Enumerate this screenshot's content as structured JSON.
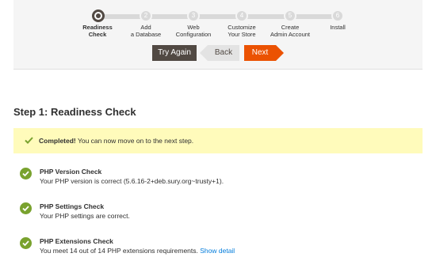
{
  "wizard": {
    "steps": [
      {
        "number": "1",
        "label_line1": "Readiness",
        "label_line2": "Check",
        "active": true
      },
      {
        "number": "2",
        "label_line1": "Add",
        "label_line2": "a Database",
        "active": false
      },
      {
        "number": "3",
        "label_line1": "Web",
        "label_line2": "Configuration",
        "active": false
      },
      {
        "number": "4",
        "label_line1": "Customize",
        "label_line2": "Your Store",
        "active": false
      },
      {
        "number": "5",
        "label_line1": "Create",
        "label_line2": "Admin Account",
        "active": false
      },
      {
        "number": "6",
        "label_line1": "Install",
        "label_line2": "",
        "active": false
      }
    ],
    "buttons": {
      "try_again": "Try Again",
      "back": "Back",
      "next": "Next"
    }
  },
  "page": {
    "title": "Step 1: Readiness Check"
  },
  "message": {
    "strong": "Completed!",
    "text": " You can now move on to the next step."
  },
  "checks": [
    {
      "title": "PHP Version Check",
      "description": "Your PHP version is correct (5.6.16-2+deb.sury.org~trusty+1).",
      "link": ""
    },
    {
      "title": "PHP Settings Check",
      "description": "Your PHP settings are correct.",
      "link": ""
    },
    {
      "title": "PHP Extensions Check",
      "description": "You meet 14 out of 14 PHP extensions requirements.",
      "link": "Show detail"
    }
  ],
  "colors": {
    "accent": "#eb5202",
    "dark_button": "#514943",
    "success_green": "#79a22e",
    "message_bg": "#fffbbb",
    "link": "#007bdb"
  }
}
